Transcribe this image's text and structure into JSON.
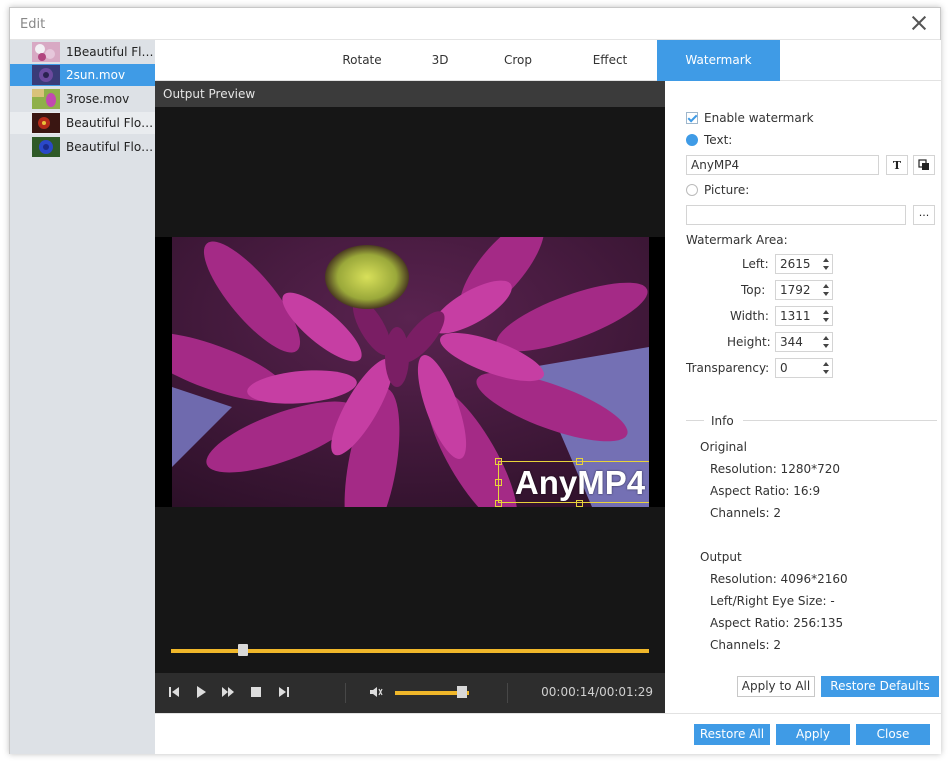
{
  "window": {
    "title": "Edit"
  },
  "files": [
    {
      "name": "1Beautiful Flo..."
    },
    {
      "name": "2sun.mov"
    },
    {
      "name": "3rose.mov"
    },
    {
      "name": "Beautiful Flow..."
    },
    {
      "name": "Beautiful Flow..."
    }
  ],
  "tabs": [
    {
      "label": "Rotate"
    },
    {
      "label": "3D"
    },
    {
      "label": "Crop"
    },
    {
      "label": "Effect"
    },
    {
      "label": "Watermark"
    }
  ],
  "preview": {
    "header": "Output Preview",
    "watermark_text": "AnyMP4",
    "time": "00:00:14/00:01:29",
    "seek_progress": 0.15,
    "volume_level": 0.9
  },
  "watermark": {
    "enable_label": "Enable watermark",
    "enabled": true,
    "text_label": "Text:",
    "text_value": "AnyMP4",
    "picture_label": "Picture:",
    "picture_value": "",
    "picture_browse": "···",
    "area_label": "Watermark Area:",
    "left_label": "Left:",
    "left_value": "2615",
    "top_label": "Top:",
    "top_value": "1792",
    "width_label": "Width:",
    "width_value": "1311",
    "height_label": "Height:",
    "height_value": "344",
    "transparency_label": "Transparency:",
    "transparency_value": "0"
  },
  "info": {
    "title": "Info",
    "original_title": "Original",
    "original_resolution": "Resolution: 1280*720",
    "original_aspect": "Aspect Ratio: 16:9",
    "original_channels": "Channels: 2",
    "output_title": "Output",
    "output_resolution": "Resolution: 4096*2160",
    "output_eye": "Left/Right Eye Size: -",
    "output_aspect": "Aspect Ratio: 256:135",
    "output_channels": "Channels: 2"
  },
  "buttons": {
    "apply_to_all": "Apply to All",
    "restore_defaults": "Restore Defaults",
    "restore_all": "Restore All",
    "apply": "Apply",
    "close": "Close"
  },
  "colors": {
    "accent": "#3f9be6",
    "progress": "#f0b72a",
    "watermark_box": "#e8d33a"
  }
}
